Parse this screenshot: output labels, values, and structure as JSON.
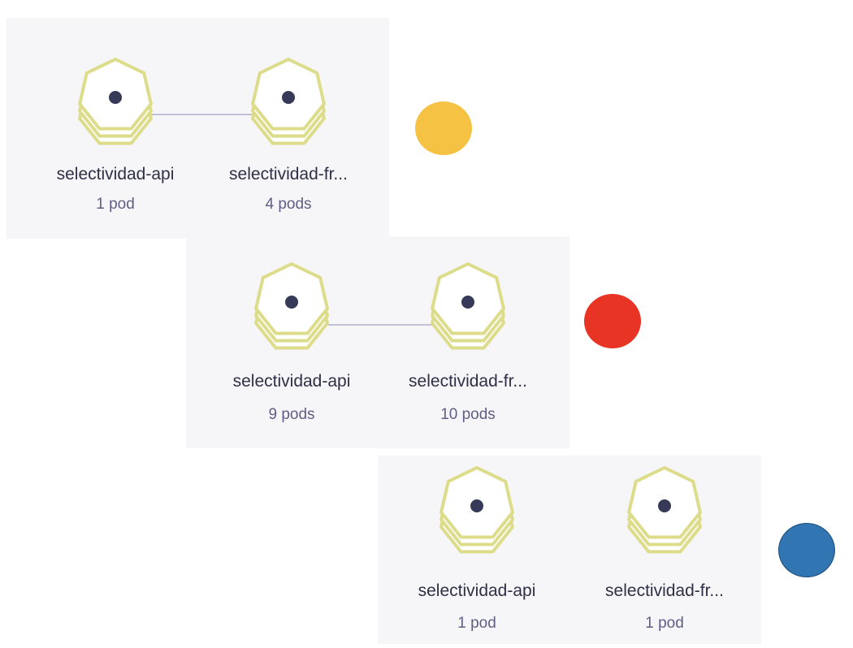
{
  "colors": {
    "panel_bg": "#f6f6f8",
    "node_stroke": "#dcdc8a",
    "node_fill": "#ffffff",
    "node_dot": "#363a58",
    "edge": "#c3c1d8",
    "label_text": "#2f2f47",
    "count_text": "#5f5e86"
  },
  "icons": {
    "node": "heptagon-stack-icon"
  },
  "panels": [
    {
      "status": {
        "name": "warning-status-dot",
        "color": "#f6c244",
        "border": "#f6c244"
      },
      "nodes": [
        {
          "name": "selectividad-api",
          "count": "1 pod"
        },
        {
          "name": "selectividad-fr...",
          "count": "4 pods"
        }
      ]
    },
    {
      "status": {
        "name": "error-status-dot",
        "color": "#e83425",
        "border": "#e83425"
      },
      "nodes": [
        {
          "name": "selectividad-api",
          "count": "9 pods"
        },
        {
          "name": "selectividad-fr...",
          "count": "10 pods"
        }
      ]
    },
    {
      "status": {
        "name": "info-status-dot",
        "color": "#3175b2",
        "border": "#1f4e7a"
      },
      "nodes": [
        {
          "name": "selectividad-api",
          "count": "1 pod"
        },
        {
          "name": "selectividad-fr...",
          "count": "1 pod"
        }
      ]
    }
  ]
}
